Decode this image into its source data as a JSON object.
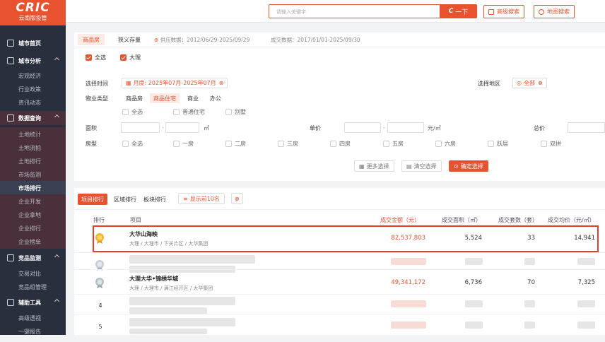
{
  "brand": {
    "logo": "CRIC",
    "subtitle": "云南版投管",
    "accent": "#e8522f"
  },
  "sidebar": {
    "groups": [
      {
        "label": "城市首页",
        "icon": "home-icon"
      },
      {
        "label": "城市分析",
        "icon": "chart-icon",
        "items": [
          "宏观经济",
          "行业政策",
          "资讯动态"
        ]
      },
      {
        "label": "数据查询",
        "icon": "database-icon",
        "items": [
          "土地统计",
          "土地流拍",
          "土地排行",
          "市场监测",
          "市场排行",
          "企业开发",
          "企业拿地",
          "企业排行",
          "企业榜单"
        ]
      },
      {
        "label": "竞品监测",
        "icon": "layers-icon",
        "items": [
          "交易对比",
          "竞品组管理"
        ]
      },
      {
        "label": "辅助工具",
        "icon": "grid-icon",
        "items": [
          "高级透视",
          "一键报告"
        ]
      }
    ],
    "active_item": "市场排行"
  },
  "topbar": {
    "search_placeholder": "请输入关键字",
    "search_button": "一下",
    "advanced_search": "高级搜索",
    "map_search": "地图搜索"
  },
  "filters": {
    "tabs": [
      "商品房",
      "狭义存量"
    ],
    "supply_data": "供应数据：2012/06/29-2025/09/29",
    "deal_data": "成交数据：2017/01/01-2025/09/30",
    "select_all": "全选",
    "city": "大理",
    "time_label": "选择时间",
    "time_value": "月度: 2025年07月-2025年07月",
    "region_label": "选择地区",
    "region_value": "全部",
    "property_label": "物业类型",
    "property_types": [
      "商品房",
      "商品住宅",
      "商业",
      "办公"
    ],
    "property_active": "商品住宅",
    "sub_types": [
      "全选",
      "普通住宅",
      "别墅"
    ],
    "area_label": "面积",
    "area_unit": "㎡",
    "price_label": "单价",
    "price_unit": "元/㎡",
    "total_label": "总价",
    "room_label": "房型",
    "rooms": [
      "全选",
      "一房",
      "二房",
      "三房",
      "四房",
      "五房",
      "六房",
      "跃层",
      "双拼"
    ],
    "more_btn": "更多选择",
    "clear_btn": "清空选择",
    "confirm_btn": "确定选择"
  },
  "ranking": {
    "tabs": [
      "项目排行",
      "区域排行",
      "板块排行"
    ],
    "show_top": "显示前10名",
    "headers": {
      "rank": "排行",
      "project": "项目",
      "amount": "成交金额（元）",
      "area": "成交面积（㎡）",
      "units": "成交套数（套）",
      "avg": "成交均价（元/㎡）"
    },
    "rows": [
      {
        "rank": "1",
        "name": "大华山海映",
        "path": "大理 / 大理市 / 下关片区 / 大华集团",
        "amount": "82,537,803",
        "area": "5,524",
        "units": "33",
        "avg": "14,941"
      },
      {
        "rank": "2",
        "name": "",
        "path": "",
        "amount": "",
        "area": "",
        "units": "",
        "avg": ""
      },
      {
        "rank": "3",
        "name": "大理大华•锦绣华城",
        "path": "大理 / 大理市 / 满江经开区 / 大华集团",
        "amount": "49,341,172",
        "area": "6,736",
        "units": "70",
        "avg": "7,325"
      },
      {
        "rank": "4",
        "name": "",
        "path": "",
        "amount": "",
        "area": "",
        "units": "",
        "avg": ""
      },
      {
        "rank": "5",
        "name": "",
        "path": "",
        "amount": "",
        "area": "",
        "units": "",
        "avg": ""
      }
    ]
  }
}
